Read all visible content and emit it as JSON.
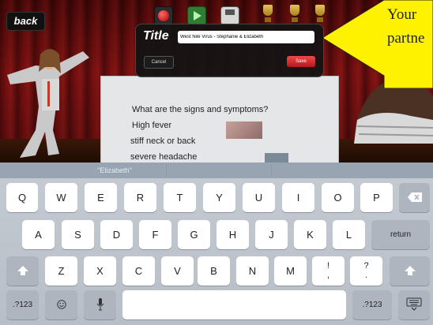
{
  "app": {
    "back_label": "back",
    "callout_text": "Your partne"
  },
  "toolbar": {
    "icons": [
      "record-icon",
      "play-icon",
      "save-disk-icon"
    ]
  },
  "title_dialog": {
    "label": "Title",
    "value": "West Nile Virus - Stephanie & Elizabeth",
    "cancel_label": "Cancel",
    "save_label": "Save"
  },
  "board": {
    "lines": [
      "What are the signs and symptoms?",
      "High fever",
      "stiff neck or back",
      "severe headache"
    ]
  },
  "keyboard": {
    "prediction": "\"Elizabeth\"",
    "row1": [
      "Q",
      "W",
      "E",
      "R",
      "T",
      "Y",
      "U",
      "I",
      "O",
      "P"
    ],
    "row2": [
      "A",
      "S",
      "D",
      "F",
      "G",
      "H",
      "J",
      "K",
      "L"
    ],
    "row3": [
      "Z",
      "X",
      "C",
      "V",
      "B",
      "N",
      "M"
    ],
    "return_label": "return",
    "numbers_label": ".?123",
    "excl_label": "!\n,",
    "question_label": "?\n.",
    "colors": {
      "key": "#ffffff",
      "modifier": "#aeb5bf",
      "background": "#c5cbd3"
    }
  }
}
